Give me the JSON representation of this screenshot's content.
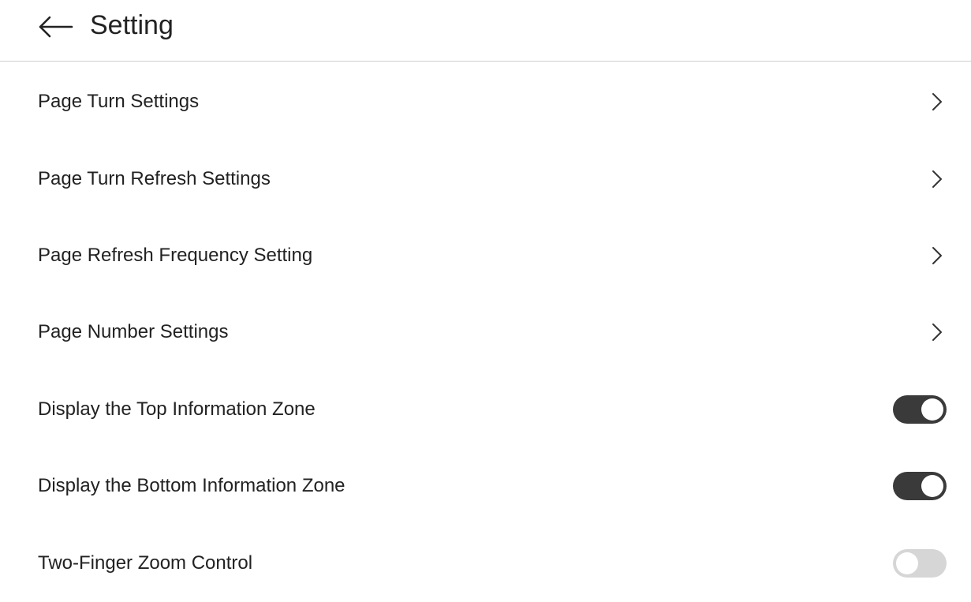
{
  "header": {
    "title": "Setting",
    "back_icon": "arrow-left-icon"
  },
  "nav_items": [
    {
      "label": "Page Turn Settings",
      "icon": "chevron-right-icon"
    },
    {
      "label": "Page Turn Refresh Settings",
      "icon": "chevron-right-icon"
    },
    {
      "label": "Page Refresh Frequency Setting",
      "icon": "chevron-right-icon"
    },
    {
      "label": "Page Number Settings",
      "icon": "chevron-right-icon"
    }
  ],
  "toggle_items": [
    {
      "label": "Display the Top Information Zone",
      "enabled": true
    },
    {
      "label": "Display the Bottom Information Zone",
      "enabled": true
    },
    {
      "label": "Two-Finger Zoom Control",
      "enabled": false
    }
  ],
  "colors": {
    "toggle_on": "#3a3a3a",
    "toggle_off": "#d6d6d6",
    "divider": "#cfcfcf",
    "text": "#222222"
  }
}
